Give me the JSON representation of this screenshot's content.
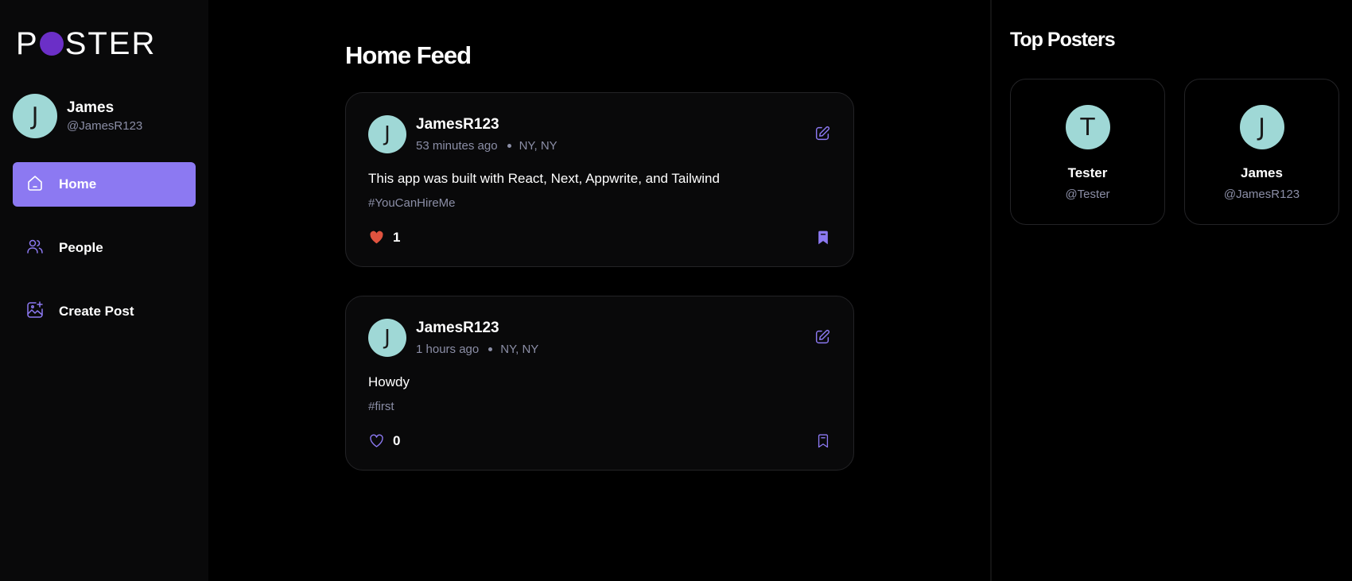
{
  "brand": {
    "logo_left": "P",
    "logo_right": "STER",
    "accent": "#8c79f2",
    "logo_dot_color": "#6b2fc7"
  },
  "user": {
    "initial": "J",
    "name": "James",
    "handle": "@JamesR123"
  },
  "nav": [
    {
      "label": "Home",
      "icon": "home-icon",
      "active": true
    },
    {
      "label": "People",
      "icon": "people-icon",
      "active": false
    },
    {
      "label": "Create Post",
      "icon": "create-post-icon",
      "active": false
    }
  ],
  "feed": {
    "title": "Home Feed",
    "posts": [
      {
        "initial": "J",
        "username": "JamesR123",
        "time": "53 minutes ago",
        "location": "NY, NY",
        "text": "This app was built with React, Next, Appwrite, and Tailwind",
        "tag": "#YouCanHireMe",
        "likes": "1",
        "liked": true,
        "saved": true
      },
      {
        "initial": "J",
        "username": "JamesR123",
        "time": "1 hours ago",
        "location": "NY, NY",
        "text": "Howdy",
        "tag": "#first",
        "likes": "0",
        "liked": false,
        "saved": false
      }
    ]
  },
  "top_posters": {
    "title": "Top Posters",
    "users": [
      {
        "initial": "T",
        "name": "Tester",
        "handle": "@Tester"
      },
      {
        "initial": "J",
        "name": "James",
        "handle": "@JamesR123"
      }
    ]
  }
}
